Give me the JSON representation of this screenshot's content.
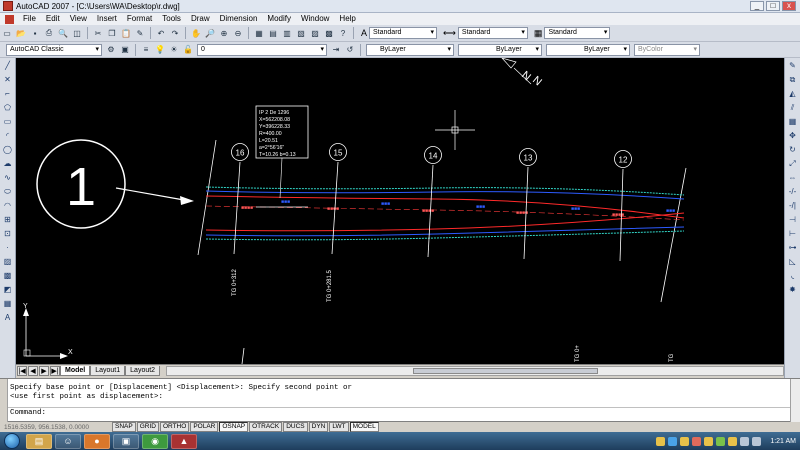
{
  "window": {
    "title": "AutoCAD 2007 - [C:\\Users\\WA\\Desktop\\r.dwg]",
    "minimize": "_",
    "maximize": "□",
    "close": "x"
  },
  "menu": [
    "File",
    "Edit",
    "View",
    "Insert",
    "Format",
    "Tools",
    "Draw",
    "Dimension",
    "Modify",
    "Window",
    "Help"
  ],
  "styles": {
    "text_style": "Standard",
    "dim_style": "Standard",
    "table_style": "Standard"
  },
  "properties": {
    "workspace": "AutoCAD Classic",
    "layer": "0",
    "color": "ByLayer",
    "linetype": "ByLayer",
    "lineweight": "ByLayer",
    "plotstyle": "ByColor"
  },
  "drawing": {
    "big_number": "1",
    "stations": [
      "16",
      "15",
      "14",
      "13",
      "12"
    ],
    "vertical_labels": [
      "TG 0+312",
      "TG 0+281.5",
      "TG 0+",
      "TG"
    ],
    "ucs_x": "X",
    "ucs_y": "Y",
    "north_arrow": "N",
    "info_box": {
      "line1": "IP 2 De 1296",
      "line2": "X=562208.08",
      "line3": "Y=396228.33",
      "line4": "R=400.00",
      "line5": "L=20.51",
      "line6": "a=2°56'16\"",
      "line7": "T=10.26 b=0.13"
    },
    "colors": {
      "road_edge": "#2d5bff",
      "road_border": "#ff2a2a",
      "hatch": "#31d6c8",
      "station_lines": "#ffffff",
      "background": "#000000"
    }
  },
  "tabs": {
    "model": "Model",
    "layout1": "Layout1",
    "layout2": "Layout2"
  },
  "command": {
    "line1": "Specify base point or [Displacement] <Displacement>: Specify second point or",
    "line2": "<use first point as displacement>:",
    "prompt": "Command:"
  },
  "status": {
    "coords": "1516.5359, 956.1538, 0.0000",
    "buttons": [
      "SNAP",
      "GRID",
      "ORTHO",
      "POLAR",
      "OSNAP",
      "OTRACK",
      "DUCS",
      "DYN",
      "LWT",
      "MODEL"
    ]
  },
  "taskbar": {
    "time": "1:21 AM"
  }
}
